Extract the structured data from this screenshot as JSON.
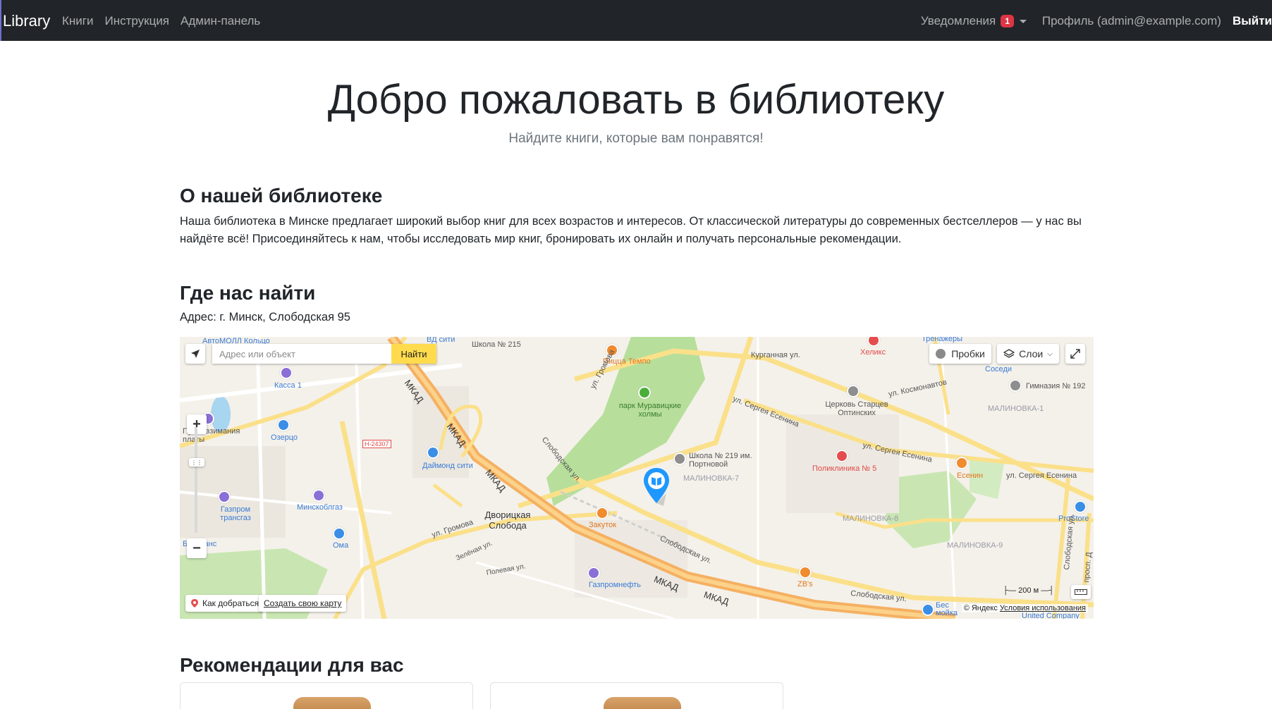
{
  "navbar": {
    "brand": "Library",
    "links": [
      "Книги",
      "Инструкция",
      "Админ-панель"
    ],
    "notifications_label": "Уведомления",
    "notifications_count": "1",
    "profile_label": "Профиль (admin@example.com)",
    "logout_label": "Выйти"
  },
  "hero": {
    "title": "Добро пожаловать в библиотеку",
    "subtitle": "Найдите книги, которые вам понравятся!"
  },
  "about": {
    "heading": "О нашей библиотеке",
    "text": "Наша библиотека в Минске предлагает широкий выбор книг для всех возрастов и интересов. От классической литературы до современных бестселлеров — у нас вы найдёте всё! Присоединяйтесь к нам, чтобы исследовать мир книг, бронировать их онлайн и получать персональные рекомендации."
  },
  "location": {
    "heading": "Где нас найти",
    "address": "Адрес: г. Минск, Слободская 95"
  },
  "map": {
    "search_placeholder": "Адрес или объект",
    "search_button": "Найти",
    "traffic_button": "Пробки",
    "layers_button": "Слои",
    "zoom_in": "+",
    "zoom_out": "−",
    "route_button": "Как добраться",
    "create_map_link": "Создать свою карту",
    "scale_label": "200 м",
    "attribution": "© Яндекс",
    "terms_link": "Условия использования",
    "labels": {
      "avtomoll": "АвтоМОЛЛ Кольцо",
      "vd_city": "ВД сити",
      "school_215": "Школа № 215",
      "pizza": "Пицца Темпо",
      "park": "парк Муравицкие холмы",
      "kurgannaya": "Курганная ул.",
      "helix": "Хеликс",
      "trenazhery": "Тренажёры",
      "sosedi": "Соседи",
      "kassa": "Касса 1",
      "gromova_top": "ул. Громова",
      "church": "Церковь Старцев Оптинских",
      "esenina_1": "ул. Сергея Есенина",
      "kosmonavtov": "ул. Космонавтов",
      "gymnasium": "Гимназия № 192",
      "malinovka_1": "МАЛИНОВКА-1",
      "tolls": "Пункт взимания платы",
      "ozertso": "Озерцо",
      "h24307": "Н-24307",
      "daimond": "Даймонд сити",
      "mkad": "МКАД",
      "slobodskaya": "Слободская ул.",
      "school_219": "Школа № 219 им. Портновой",
      "malinovka_7": "МАЛИНОВКА-7",
      "polyclinic": "Поликлиника № 5",
      "esenina_2": "ул. Сергея Есенина",
      "esenin": "Есенин",
      "esenina_3": "ул. Сергея Есенина",
      "gazprom_transgaz": "Газпром трансгаз",
      "minskoblgaz": "Минскоблгаз",
      "dvoritskaya": "Дворицкая Слобода",
      "zakutok": "Закуток",
      "malinovka_8": "МАЛИНОВКА-8",
      "prostore": "ProStore",
      "oma": "Ома",
      "btrans": "Белтранс",
      "zelenaya": "Зелёная ул.",
      "polevaya": "Полевая ул.",
      "gazpromneft": "Газпромнефть",
      "zbs": "ZB's",
      "malinovka_9": "МАЛИНОВКА-9",
      "slobodskaya_2": "Слободская ул.",
      "slobodskaya_3": "Слободская ул.",
      "bes_moika": "Бес мойка",
      "united": "United Company",
      "prosp": "просп. Д"
    }
  },
  "recommendations": {
    "heading": "Рекомендации для вас"
  },
  "colors": {
    "navbar_bg": "#212529",
    "badge": "#dc3545",
    "search_button": "#ffdb4d",
    "mkad": "#f5b062",
    "park": "#b7df9b",
    "map_bg": "#f4f1ea"
  }
}
